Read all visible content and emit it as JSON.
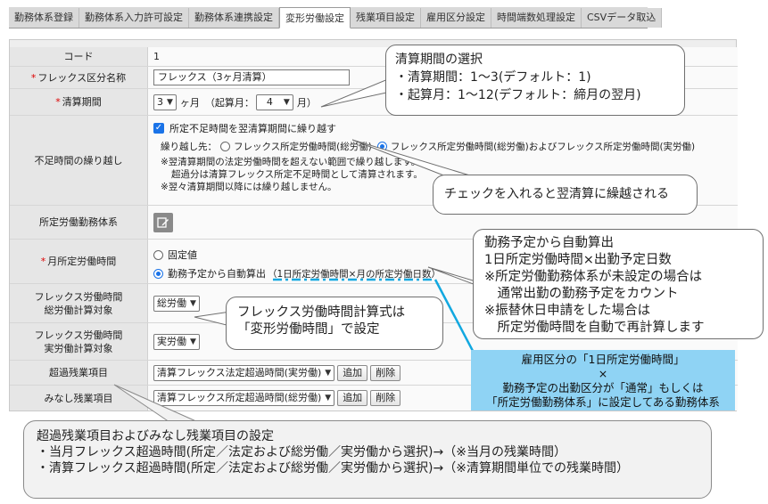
{
  "tabs": [
    {
      "label": "勤務体系登録",
      "active": false
    },
    {
      "label": "勤務体系入力許可設定",
      "active": false
    },
    {
      "label": "勤務体系連携設定",
      "active": false
    },
    {
      "label": "変形労働設定",
      "active": true
    },
    {
      "label": "残業項目設定",
      "active": false
    },
    {
      "label": "雇用区分設定",
      "active": false
    },
    {
      "label": "時間端数処理設定",
      "active": false
    },
    {
      "label": "CSVデータ取込",
      "active": false
    }
  ],
  "form": {
    "code": {
      "label": "コード",
      "value": "1"
    },
    "flex_name": {
      "label": "フレックス区分名称",
      "value": "フレックス（3ヶ月清算）"
    },
    "settlement": {
      "label": "清算期間",
      "months": "3",
      "unit": "ヶ月",
      "start_prefix": "（起算月：",
      "start_month": "4",
      "start_suffix": "月）"
    },
    "carryover": {
      "label": "不足時間の繰り越し",
      "checkbox_label": "所定不足時間を翌清算期間に繰り越す",
      "checked": true,
      "dest_label": "繰り越し先：",
      "option1": "フレックス所定労働時間(総労働)",
      "option2": "フレックス所定労働時間(総労働)およびフレックス所定労働時間(実労働)",
      "selected": 2,
      "note1": "※翌清算期間の法定労働時間を超えない範囲で繰り越します。",
      "note2": "超過分は清算フレックス所定不足時間として清算されます。",
      "note3": "※翌々清算期間以降には繰り越しません。"
    },
    "schedule": {
      "label": "所定労働勤務体系",
      "icon": "edit-icon"
    },
    "monthly": {
      "label": "月所定労働時間",
      "option1": "固定値",
      "option2": "勤務予定から自動算出",
      "option2_note": "（1日所定労働時間×月の所定労働日数）",
      "selected": 2
    },
    "flex_total": {
      "label1": "フレックス労働時間",
      "label2": "総労働計算対象",
      "value": "総労働"
    },
    "flex_actual": {
      "label1": "フレックス労働時間",
      "label2": "実労働計算対象",
      "value": "実労働"
    },
    "overtime": {
      "label": "超過残業項目",
      "value": "清算フレックス法定超過時間(実労働)",
      "add": "追加",
      "delete": "削除"
    },
    "deemed": {
      "label": "みなし残業項目",
      "value": "清算フレックス所定超過時間(総労働)",
      "add": "追加",
      "delete": "削除"
    }
  },
  "callouts": {
    "settlement": [
      "清算期間の選択",
      "・清算期間：1～3(デフォルト：1)",
      "・起算月：1～12(デフォルト：締月の翌月)"
    ],
    "carry": "チェックを入れると翌清算に繰越される",
    "auto": [
      "勤務予定から自動算出",
      "1日所定労働時間×出勤予定日数",
      "※所定労働勤務体系が未設定の場合は",
      "　通常出勤の勤務予定をカウント",
      "※振替休日申請をした場合は",
      "　所定労働時間を自動で再計算します"
    ],
    "formula": [
      "フレックス労働時間計算式は",
      "「変形労働時間」で設定"
    ],
    "blue": [
      "雇用区分の「1日所定労働時間」",
      "×",
      "勤務予定の出勤区分が「通常」もしくは",
      "「所定労働勤務体系」に設定してある勤務体系"
    ],
    "overtime": [
      "超過残業項目およびみなし残業項目の設定",
      "・当月フレックス超過時間(所定／法定および総労働／実労働から選択)→（※当月の残業時間）",
      "・清算フレックス超過時間(所定／法定および総労働／実労働から選択)→（※清算期間単位での残業時間）"
    ]
  },
  "colors": {
    "accent": "#1a73e8",
    "required": "#dd0000",
    "note_blue": "#8fd3f4",
    "dash_line": "#12a8e0"
  }
}
